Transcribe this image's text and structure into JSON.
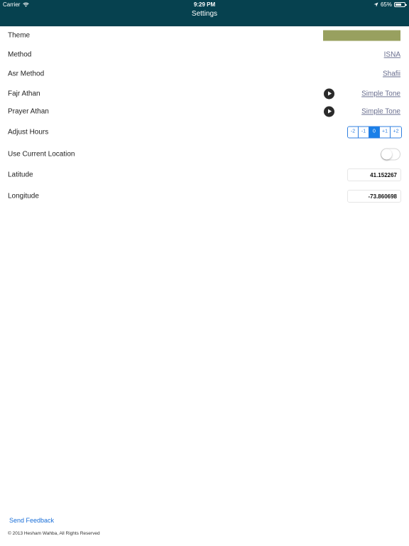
{
  "status_bar": {
    "carrier": "Carrier",
    "time": "9:29 PM",
    "battery": "65%",
    "battery_level": 0.65
  },
  "nav": {
    "title": "Settings"
  },
  "settings": {
    "theme": {
      "label": "Theme",
      "color": "#98a05f"
    },
    "method": {
      "label": "Method",
      "value": "ISNA"
    },
    "asr_method": {
      "label": "Asr Method",
      "value": "Shafii"
    },
    "fajr_athan": {
      "label": "Fajr Athan",
      "value": "Simple Tone"
    },
    "prayer_athan": {
      "label": "Prayer Athan",
      "value": "Simple Tone"
    },
    "adjust_hours": {
      "label": "Adjust Hours",
      "options": [
        "-2",
        "-1",
        "0",
        "+1",
        "+2"
      ],
      "selected": "0"
    },
    "use_current_location": {
      "label": "Use Current Location",
      "enabled": false
    },
    "latitude": {
      "label": "Latitude",
      "value": "41.152267"
    },
    "longitude": {
      "label": "Longitude",
      "value": "-73.860698"
    }
  },
  "footer": {
    "feedback": "Send Feedback",
    "copyright": "© 2013 Hesham Wahba, All Rights Reserved"
  },
  "colors": {
    "nav_background": "#06414f",
    "accent": "#1a7fe8",
    "link": "#6a6f8f"
  }
}
